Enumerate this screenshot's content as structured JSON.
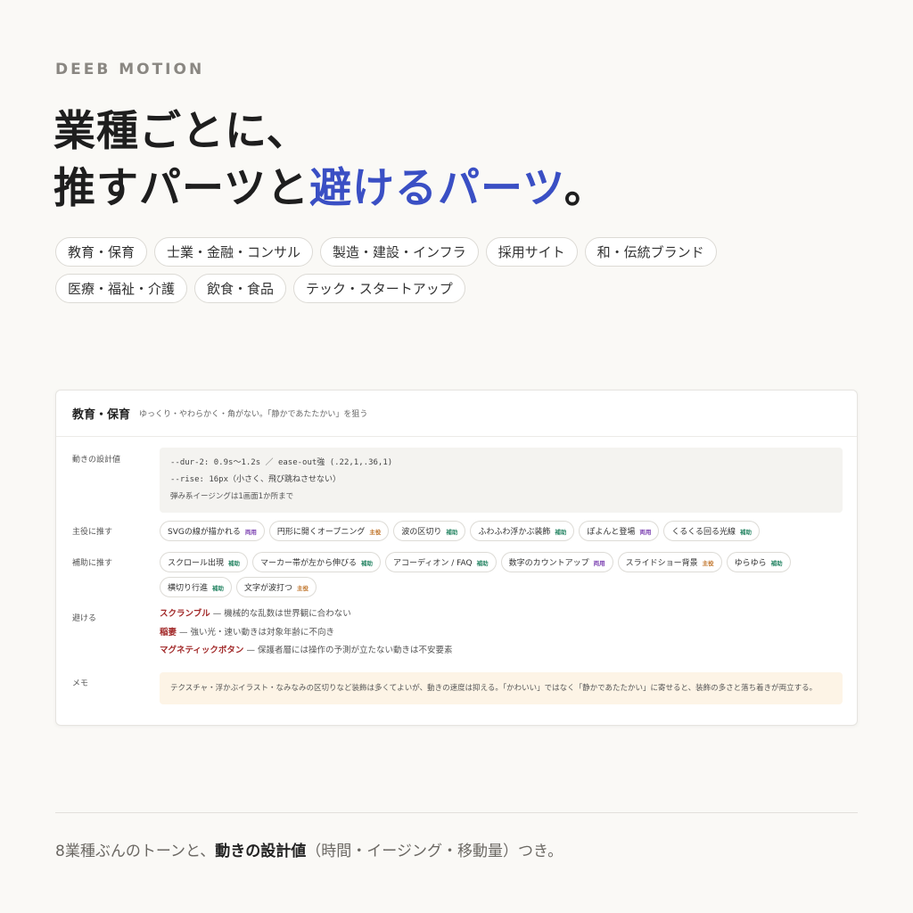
{
  "brand": "DEEB MOTION",
  "headline": {
    "line1": "業種ごとに、",
    "line2_prefix": "推すパーツと",
    "line2_accent": "避けるパーツ",
    "line2_suffix": "。"
  },
  "industries": [
    "教育・保育",
    "士業・金融・コンサル",
    "製造・建設・インフラ",
    "採用サイト",
    "和・伝統ブランド",
    "医療・福祉・介護",
    "飲食・食品",
    "テック・スタートアップ"
  ],
  "card": {
    "title": "教育・保育",
    "subtitle": "ゆっくり・やわらかく・角がない。「静かであたたかい」を狙う",
    "design_label": "動きの設計値",
    "design_code1": "--dur-2: 0.9s〜1.2s ／ ease-out強 (.22,1,.36,1)",
    "design_code2": "--rise: 16px（小さく、飛び跳ねさせない）",
    "design_note": "弾み系イージングは1画面1か所まで",
    "main_label": "主役に推す",
    "main_items": [
      {
        "label": "SVGの線が描かれる",
        "badge": "両用",
        "kind": "both"
      },
      {
        "label": "円形に開くオープニング",
        "badge": "主役",
        "kind": "main"
      },
      {
        "label": "波の区切り",
        "badge": "補助",
        "kind": "sub"
      },
      {
        "label": "ふわふわ浮かぶ装飾",
        "badge": "補助",
        "kind": "sub"
      },
      {
        "label": "ぽよんと登場",
        "badge": "両用",
        "kind": "both"
      },
      {
        "label": "くるくる回る光線",
        "badge": "補助",
        "kind": "sub"
      }
    ],
    "sub_label": "補助に推す",
    "sub_items": [
      {
        "label": "スクロール出現",
        "badge": "補助",
        "kind": "sub"
      },
      {
        "label": "マーカー帯が左から伸びる",
        "badge": "補助",
        "kind": "sub"
      },
      {
        "label": "アコーディオン / FAQ",
        "badge": "補助",
        "kind": "sub"
      },
      {
        "label": "数字のカウントアップ",
        "badge": "両用",
        "kind": "both"
      },
      {
        "label": "スライドショー背景",
        "badge": "主役",
        "kind": "main"
      },
      {
        "label": "ゆらゆら",
        "badge": "補助",
        "kind": "sub"
      },
      {
        "label": "横切り行進",
        "badge": "補助",
        "kind": "sub"
      },
      {
        "label": "文字が波打つ",
        "badge": "主役",
        "kind": "main"
      }
    ],
    "avoid_label": "避ける",
    "avoid_items": [
      {
        "term": "スクランブル",
        "reason": " — 機械的な乱数は世界観に合わない"
      },
      {
        "term": "稲妻",
        "reason": " — 強い光・速い動きは対象年齢に不向き"
      },
      {
        "term": "マグネティックボタン",
        "reason": " — 保護者層には操作の予測が立たない動きは不安要素"
      }
    ],
    "memo_label": "メモ",
    "memo_text": "テクスチャ・浮かぶイラスト・なみなみの区切りなど装飾は多くてよいが、動きの速度は抑える。「かわいい」ではなく「静かであたたかい」に寄せると、装飾の多さと落ち着きが両立する。"
  },
  "footer": {
    "prefix": "8業種ぶんのトーンと、",
    "bold": "動きの設計値",
    "suffix": "（時間・イージング・移動量）つき。"
  }
}
